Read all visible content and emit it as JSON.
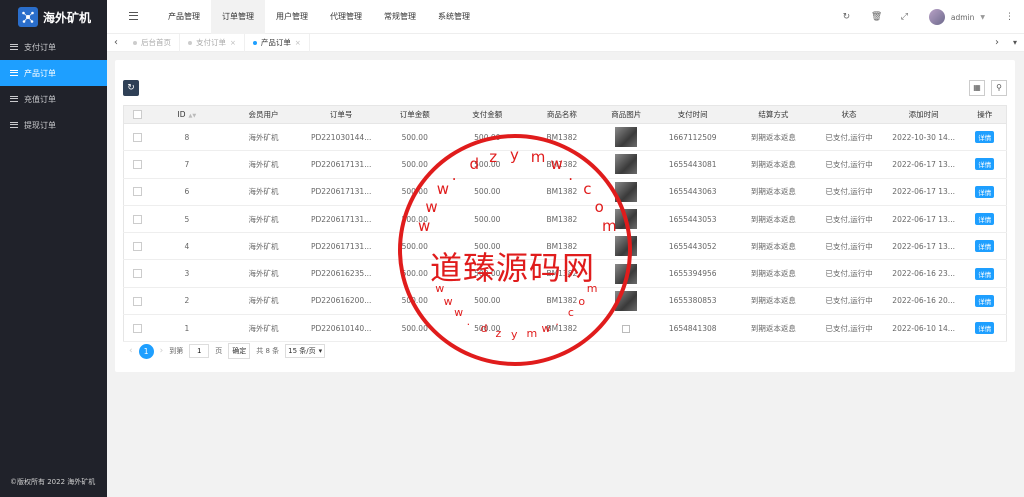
{
  "app": {
    "title": "海外矿机",
    "footer": "©版权所有 2022 海外矿机"
  },
  "sidebar": {
    "items": [
      {
        "label": "支付订单",
        "active": false
      },
      {
        "label": "产品订单",
        "active": true
      },
      {
        "label": "充值订单",
        "active": false
      },
      {
        "label": "提现订单",
        "active": false
      }
    ]
  },
  "header": {
    "menu": [
      "产品管理",
      "订单管理",
      "用户管理",
      "代理管理",
      "常规管理",
      "系统管理"
    ],
    "active_menu": "订单管理",
    "user": "admin"
  },
  "tabs": [
    {
      "label": "后台首页",
      "closable": false
    },
    {
      "label": "支付订单",
      "closable": true
    },
    {
      "label": "产品订单",
      "closable": true,
      "active": true
    }
  ],
  "table": {
    "columns": [
      "ID",
      "会员用户",
      "订单号",
      "订单金额",
      "支付金额",
      "商品名称",
      "商品图片",
      "支付时间",
      "结算方式",
      "状态",
      "添加时间",
      "操作"
    ],
    "rows": [
      {
        "id": "8",
        "user": "海外矿机",
        "order_no": "PD221030144...",
        "order_amount": "500.00",
        "pay_amount": "500.00",
        "product": "BM1382",
        "image": "product-image",
        "pay_time": "1667112509",
        "settle": "到期返本返息",
        "status": "已支付,运行中",
        "added": "2022-10-30 14...",
        "action": "详情"
      },
      {
        "id": "7",
        "user": "海外矿机",
        "order_no": "PD220617131...",
        "order_amount": "500.00",
        "pay_amount": "500.00",
        "product": "BM1382",
        "image": "product-image",
        "pay_time": "1655443081",
        "settle": "到期返本返息",
        "status": "已支付,运行中",
        "added": "2022-06-17 13...",
        "action": "详情"
      },
      {
        "id": "6",
        "user": "海外矿机",
        "order_no": "PD220617131...",
        "order_amount": "500.00",
        "pay_amount": "500.00",
        "product": "BM1382",
        "image": "product-image",
        "pay_time": "1655443063",
        "settle": "到期返本返息",
        "status": "已支付,运行中",
        "added": "2022-06-17 13...",
        "action": "详情"
      },
      {
        "id": "5",
        "user": "海外矿机",
        "order_no": "PD220617131...",
        "order_amount": "500.00",
        "pay_amount": "500.00",
        "product": "BM1382",
        "image": "product-image",
        "pay_time": "1655443053",
        "settle": "到期返本返息",
        "status": "已支付,运行中",
        "added": "2022-06-17 13...",
        "action": "详情"
      },
      {
        "id": "4",
        "user": "海外矿机",
        "order_no": "PD220617131...",
        "order_amount": "500.00",
        "pay_amount": "500.00",
        "product": "BM1382",
        "image": "product-image",
        "pay_time": "1655443052",
        "settle": "到期返本返息",
        "status": "已支付,运行中",
        "added": "2022-06-17 13...",
        "action": "详情"
      },
      {
        "id": "3",
        "user": "海外矿机",
        "order_no": "PD220616235...",
        "order_amount": "500.00",
        "pay_amount": "500.00",
        "product": "BM1382",
        "image": "product-image",
        "pay_time": "1655394956",
        "settle": "到期返本返息",
        "status": "已支付,运行中",
        "added": "2022-06-16 23...",
        "action": "详情"
      },
      {
        "id": "2",
        "user": "海外矿机",
        "order_no": "PD220616200...",
        "order_amount": "500.00",
        "pay_amount": "500.00",
        "product": "BM1382",
        "image": "product-image",
        "pay_time": "1655380853",
        "settle": "到期返本返息",
        "status": "已支付,运行中",
        "added": "2022-06-16 20...",
        "action": "详情"
      },
      {
        "id": "1",
        "user": "海外矿机",
        "order_no": "PD220610140...",
        "order_amount": "500.00",
        "pay_amount": "500.00",
        "product": "BM1382",
        "image": "broken-image",
        "pay_time": "1654841308",
        "settle": "到期返本返息",
        "status": "已支付,运行中",
        "added": "2022-06-10 14...",
        "action": "详情"
      }
    ]
  },
  "pagination": {
    "current_page": "1",
    "goto_label": "到第",
    "goto_value": "1",
    "page_unit": "页",
    "confirm": "确定",
    "total": "共 8 条",
    "page_size": "15 条/页"
  },
  "watermark": {
    "center_text": "道臻源码网",
    "top_arc": "www.dzymw.com",
    "bottom_arc": "www.dzymw.com"
  },
  "colors": {
    "primary": "#1E9FFF",
    "sidebar_bg": "#20222a",
    "stamp": "#e01c1c"
  }
}
